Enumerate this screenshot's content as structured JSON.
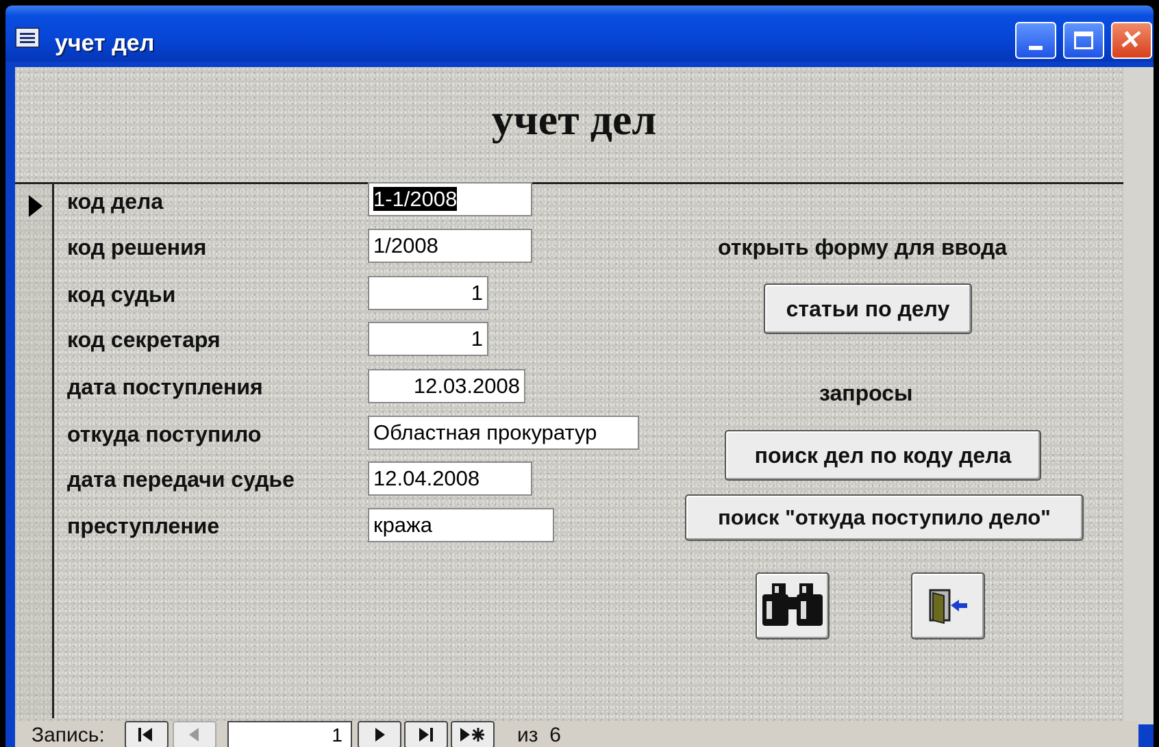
{
  "window": {
    "title": "учет дел",
    "minimize_icon": "minimize-icon",
    "maximize_icon": "maximize-icon",
    "close_icon": "close-icon"
  },
  "form": {
    "title": "учет дел",
    "fields": [
      {
        "label": "код дела",
        "value": "1-1/2008"
      },
      {
        "label": "код решения",
        "value": "1/2008"
      },
      {
        "label": "код судьи",
        "value": "1"
      },
      {
        "label": "код секретаря",
        "value": "1"
      },
      {
        "label": "дата поступления",
        "value": "12.03.2008"
      },
      {
        "label": "откуда поступило",
        "value": "Областная прокуратур"
      },
      {
        "label": "дата передачи судье",
        "value": "12.04.2008"
      },
      {
        "label": "преступление",
        "value": "кража"
      }
    ],
    "open_form_caption": "открыть форму для ввода",
    "articles_button": "статьи по делу",
    "queries_caption": "запросы",
    "search_by_code_button": "поиск дел по коду дела",
    "search_source_button": "поиск \"откуда поступило дело\"",
    "find_icon": "binoculars-icon",
    "exit_icon": "exit-door-icon"
  },
  "navigation": {
    "label": "Запись:",
    "current": "1",
    "of_label": "из",
    "total": "6",
    "first_icon": "first-record-icon",
    "prev_icon": "previous-record-icon",
    "next_icon": "next-record-icon",
    "last_icon": "last-record-icon",
    "new_icon": "new-record-icon"
  },
  "colors": {
    "titlebar": "#0645d6",
    "form_background": "#c9c8c2",
    "close_button": "#d8401c"
  }
}
